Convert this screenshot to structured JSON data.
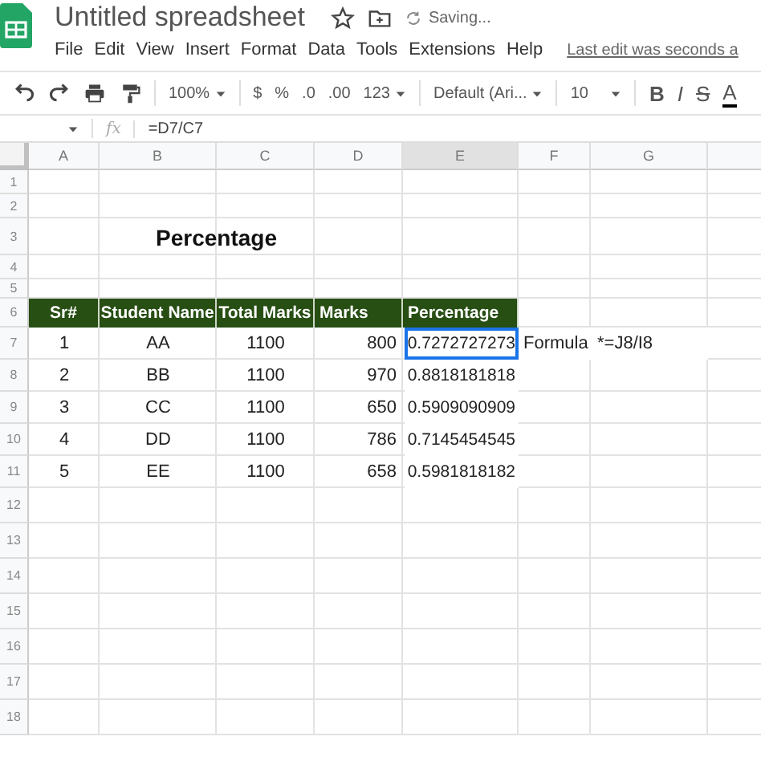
{
  "doc": {
    "title": "Untitled spreadsheet",
    "status": "Saving..."
  },
  "menu": [
    "File",
    "Edit",
    "View",
    "Insert",
    "Format",
    "Data",
    "Tools",
    "Extensions",
    "Help"
  ],
  "last_edit": "Last edit was seconds a",
  "toolbar": {
    "zoom": "100%",
    "currency": "$",
    "percent": "%",
    "dec_less": ".0",
    "dec_more": ".00",
    "format": "123",
    "font": "Default (Ari...",
    "size": "10",
    "bold": "B",
    "italic": "I",
    "strike": "S",
    "text_color_label": "A"
  },
  "formula_bar": {
    "fx": "fx",
    "formula": "=D7/C7"
  },
  "columns": [
    {
      "label": "A",
      "selected": false
    },
    {
      "label": "B",
      "selected": false
    },
    {
      "label": "C",
      "selected": false
    },
    {
      "label": "D",
      "selected": false
    },
    {
      "label": "E",
      "selected": true
    },
    {
      "label": "F",
      "selected": false
    },
    {
      "label": "G",
      "selected": false
    }
  ],
  "rows": [
    "1",
    "2",
    "3",
    "4",
    "5",
    "6",
    "7",
    "8",
    "9",
    "10",
    "11",
    "12",
    "13",
    "14",
    "15",
    "16",
    "17",
    "18"
  ],
  "sheet_title": "Percentage",
  "table": {
    "headers": [
      "Sr#",
      "Student Name",
      "Total Marks",
      "Marks",
      "Percentage"
    ],
    "rows": [
      {
        "cells": [
          "1",
          "AA",
          "1100",
          "800",
          "0.7272727273"
        ],
        "selected": true
      },
      {
        "cells": [
          "2",
          "BB",
          "1100",
          "970",
          "0.8818181818"
        ],
        "selected": false
      },
      {
        "cells": [
          "3",
          "CC",
          "1100",
          "650",
          "0.5909090909"
        ],
        "selected": false
      },
      {
        "cells": [
          "4",
          "DD",
          "1100",
          "786",
          "0.7145454545"
        ],
        "selected": false
      },
      {
        "cells": [
          "5",
          "EE",
          "1100",
          "658",
          "0.5981818182"
        ],
        "selected": false
      }
    ]
  },
  "note": {
    "label": "Formula",
    "formula": "*=J8/I8"
  }
}
